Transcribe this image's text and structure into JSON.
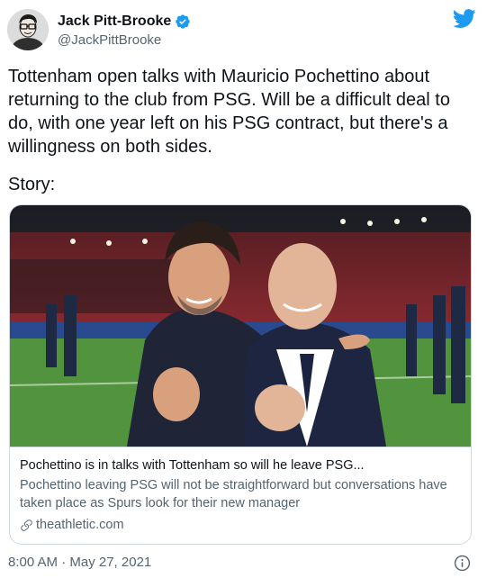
{
  "author": {
    "name": "Jack Pitt-Brooke",
    "handle": "@JackPittBrooke",
    "verified": true
  },
  "tweet": {
    "text": "Tottenham open talks with Mauricio Pochettino about\nreturning to the club from PSG. Will be a difficult deal to\ndo, with one year left on his PSG contract, but there's a\nwillingness on both sides.",
    "story_label": "Story:",
    "timestamp": "8:00 AM · May 27, 2021"
  },
  "card": {
    "title": "Pochettino is in talks with Tottenham so will he leave PSG...",
    "description": "Pochettino leaving PSG will not be straightforward but conversations have taken place as Spurs look for their new manager",
    "domain": "theathletic.com"
  },
  "colors": {
    "brand_blue": "#1d9bf0",
    "text_primary": "#0f1419",
    "text_secondary": "#536471",
    "border": "#cfd9de"
  },
  "icons": {
    "logo": "twitter-bird-icon",
    "verified": "verified-badge-icon",
    "link": "link-icon",
    "info": "info-icon"
  }
}
